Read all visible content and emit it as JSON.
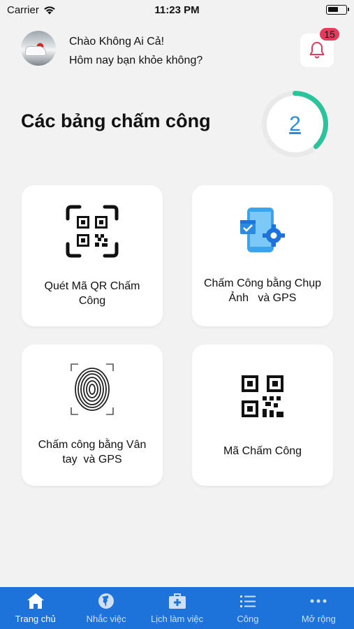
{
  "status_bar": {
    "carrier": "Carrier",
    "time": "11:23 PM"
  },
  "header": {
    "greeting": "Chào Không Ai Cả!",
    "subgreeting": "Hôm nay bạn khỏe không?",
    "notification_count": "15"
  },
  "section": {
    "title": "Các bảng chấm công",
    "count": "2",
    "ring_progress": 0.38
  },
  "cards": [
    {
      "label": "Quét Mã QR Chấm\nCông",
      "icon": "qr-scan-icon"
    },
    {
      "label": "Chấm Công bằng Chụp\nẢnh   và GPS",
      "icon": "phone-settings-icon"
    },
    {
      "label": "Chấm công bằng Vân\ntay  và GPS",
      "icon": "fingerprint-icon"
    },
    {
      "label": "Mã Chấm Công",
      "icon": "qr-code-icon"
    }
  ],
  "tabs": [
    {
      "label": "Trang chủ",
      "icon": "home-icon",
      "active": true
    },
    {
      "label": "Nhắc việc",
      "icon": "globe-icon",
      "active": false
    },
    {
      "label": "Lịch làm việc",
      "icon": "briefcase-icon",
      "active": false
    },
    {
      "label": "Công",
      "icon": "list-icon",
      "active": false
    },
    {
      "label": "Mở rộng",
      "icon": "more-icon",
      "active": false
    }
  ],
  "colors": {
    "accent": "#1d73d9",
    "ring": "#2bc39a",
    "badge": "#e53a5c",
    "bell": "#e53a5c",
    "counter": "#2a8be0"
  }
}
